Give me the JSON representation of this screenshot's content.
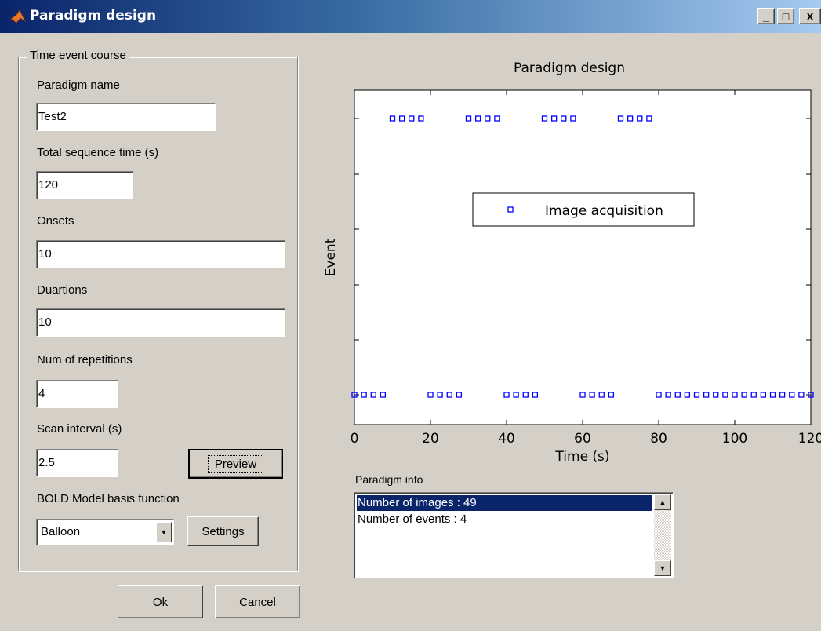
{
  "window": {
    "title": "Paradigm design",
    "minimize_glyph": "_",
    "maximize_glyph": "□",
    "close_glyph": "X"
  },
  "group": {
    "title": "Time event course"
  },
  "form": {
    "paradigm_name_label": "Paradigm name",
    "paradigm_name_value": "Test2",
    "total_time_label": "Total sequence time (s)",
    "total_time_value": "120",
    "onsets_label": "Onsets",
    "onsets_value": "10",
    "durations_label": "Duartions",
    "durations_value": "10",
    "repetitions_label": "Num of repetitions",
    "repetitions_value": "4",
    "scan_interval_label": "Scan interval (s)",
    "scan_interval_value": "2.5",
    "preview_label": "Preview",
    "basis_label": "BOLD Model basis function",
    "basis_value": "Balloon",
    "settings_label": "Settings"
  },
  "footer": {
    "ok_label": "Ok",
    "cancel_label": "Cancel"
  },
  "info": {
    "label": "Paradigm info",
    "items": [
      "Number of images : 49",
      "Number of events : 4"
    ]
  },
  "chart_data": {
    "type": "scatter",
    "title": "Paradigm design",
    "xlabel": "Time (s)",
    "ylabel": "Event",
    "xlim": [
      0,
      120
    ],
    "ylim": [
      0,
      1
    ],
    "xticks": [
      0,
      20,
      40,
      60,
      80,
      100,
      120
    ],
    "legend": {
      "entries": [
        "Image acquisition"
      ],
      "position": "center"
    },
    "marker": "square",
    "color": "#0000ff",
    "series": [
      {
        "name": "Image acquisition",
        "points": [
          {
            "x": 0,
            "y": 0
          },
          {
            "x": 2.5,
            "y": 0
          },
          {
            "x": 5,
            "y": 0
          },
          {
            "x": 7.5,
            "y": 0
          },
          {
            "x": 10,
            "y": 1
          },
          {
            "x": 12.5,
            "y": 1
          },
          {
            "x": 15,
            "y": 1
          },
          {
            "x": 17.5,
            "y": 1
          },
          {
            "x": 20,
            "y": 0
          },
          {
            "x": 22.5,
            "y": 0
          },
          {
            "x": 25,
            "y": 0
          },
          {
            "x": 27.5,
            "y": 0
          },
          {
            "x": 30,
            "y": 1
          },
          {
            "x": 32.5,
            "y": 1
          },
          {
            "x": 35,
            "y": 1
          },
          {
            "x": 37.5,
            "y": 1
          },
          {
            "x": 40,
            "y": 0
          },
          {
            "x": 42.5,
            "y": 0
          },
          {
            "x": 45,
            "y": 0
          },
          {
            "x": 47.5,
            "y": 0
          },
          {
            "x": 50,
            "y": 1
          },
          {
            "x": 52.5,
            "y": 1
          },
          {
            "x": 55,
            "y": 1
          },
          {
            "x": 57.5,
            "y": 1
          },
          {
            "x": 60,
            "y": 0
          },
          {
            "x": 62.5,
            "y": 0
          },
          {
            "x": 65,
            "y": 0
          },
          {
            "x": 67.5,
            "y": 0
          },
          {
            "x": 70,
            "y": 1
          },
          {
            "x": 72.5,
            "y": 1
          },
          {
            "x": 75,
            "y": 1
          },
          {
            "x": 77.5,
            "y": 1
          },
          {
            "x": 80,
            "y": 0
          },
          {
            "x": 82.5,
            "y": 0
          },
          {
            "x": 85,
            "y": 0
          },
          {
            "x": 87.5,
            "y": 0
          },
          {
            "x": 90,
            "y": 0
          },
          {
            "x": 92.5,
            "y": 0
          },
          {
            "x": 95,
            "y": 0
          },
          {
            "x": 97.5,
            "y": 0
          },
          {
            "x": 100,
            "y": 0
          },
          {
            "x": 102.5,
            "y": 0
          },
          {
            "x": 105,
            "y": 0
          },
          {
            "x": 107.5,
            "y": 0
          },
          {
            "x": 110,
            "y": 0
          },
          {
            "x": 112.5,
            "y": 0
          },
          {
            "x": 115,
            "y": 0
          },
          {
            "x": 117.5,
            "y": 0
          },
          {
            "x": 120,
            "y": 0
          }
        ]
      }
    ]
  }
}
